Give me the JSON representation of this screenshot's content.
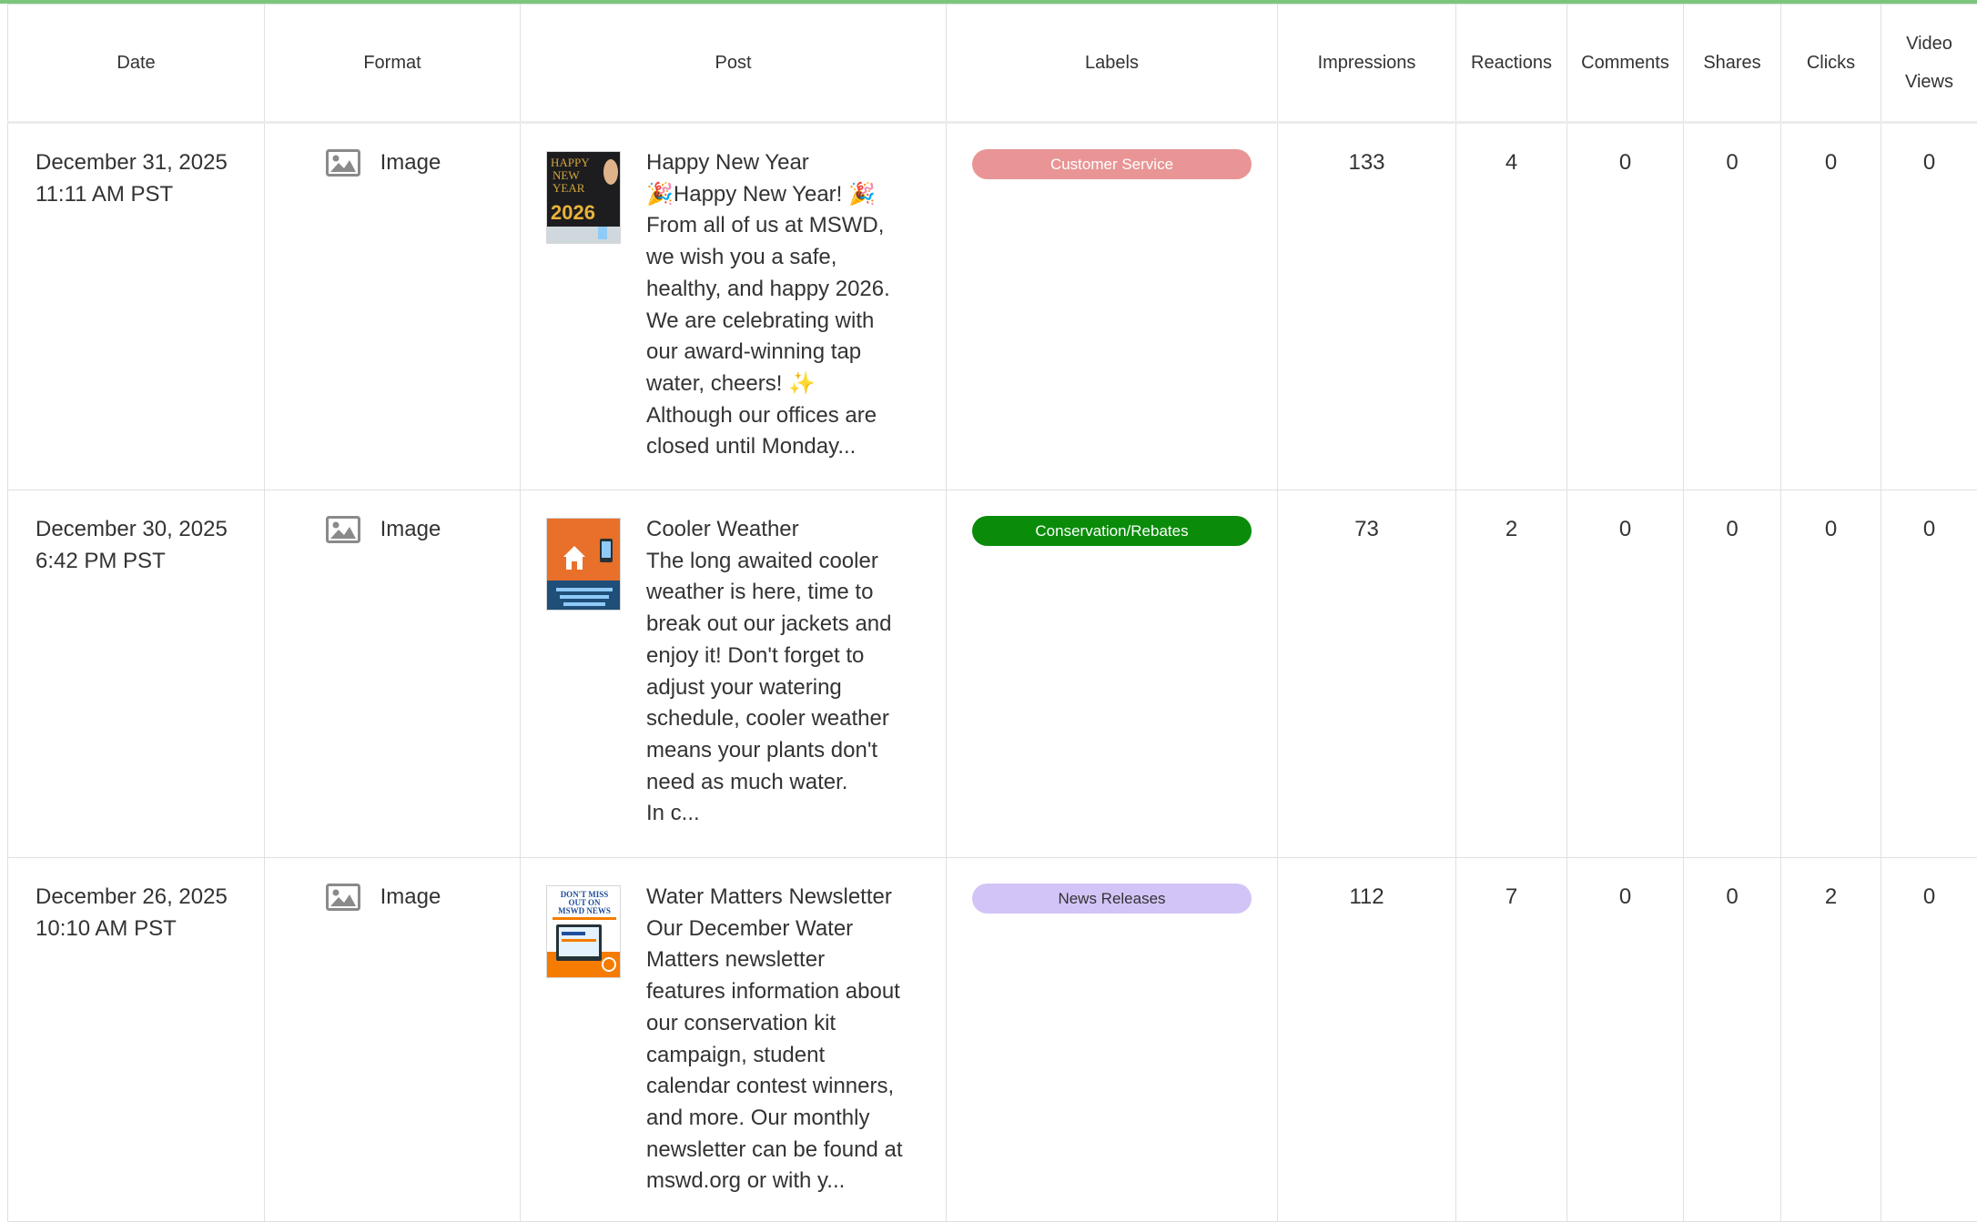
{
  "columns": {
    "date": "Date",
    "format": "Format",
    "post": "Post",
    "labels": "Labels",
    "impressions": "Impressions",
    "reactions": "Reactions",
    "comments": "Comments",
    "shares": "Shares",
    "clicks": "Clicks",
    "video_views_line1": "Video",
    "video_views_line2": "Views"
  },
  "rows": [
    {
      "date": "December 31, 2025",
      "time": "11:11 AM PST",
      "format": "Image",
      "format_icon": "image-icon",
      "post_lines": [
        "Happy New Year",
        "🎉Happy New Year! 🎉",
        "From all of us at MSWD,",
        "we wish you a safe,",
        "healthy, and happy 2026.",
        "We are celebrating with",
        "our award-winning tap",
        "water, cheers! ✨",
        "Although our offices are",
        "closed until Monday..."
      ],
      "thumbnail_text": [
        "HAPPY",
        "NEW",
        "YEAR",
        "2026"
      ],
      "label": "Customer Service",
      "label_color": "#e99595",
      "label_text_color": "#ffffff",
      "impressions": "133",
      "reactions": "4",
      "comments": "0",
      "shares": "0",
      "clicks": "0",
      "video_views": "0"
    },
    {
      "date": "December 30, 2025",
      "time": "6:42 PM PST",
      "format": "Image",
      "format_icon": "image-icon",
      "post_lines": [
        "Cooler Weather",
        "The long awaited cooler",
        "weather is here, time to",
        "break out our jackets and",
        "enjoy it! Don't forget to",
        "adjust your watering",
        "schedule, cooler weather",
        "means your plants don't",
        "need as much water.",
        "In c..."
      ],
      "thumbnail_text": [],
      "label": "Conservation/Rebates",
      "label_color": "#0a8c0a",
      "label_text_color": "#ffffff",
      "impressions": "73",
      "reactions": "2",
      "comments": "0",
      "shares": "0",
      "clicks": "0",
      "video_views": "0"
    },
    {
      "date": "December 26, 2025",
      "time": "10:10 AM PST",
      "format": "Image",
      "format_icon": "image-icon",
      "post_lines": [
        "Water Matters Newsletter",
        "Our December Water",
        "Matters newsletter",
        "features information about",
        "our conservation kit",
        "campaign, student",
        "calendar contest winners,",
        "and more. Our monthly",
        "newsletter can be found at",
        "mswd.org or with y..."
      ],
      "thumbnail_text": [
        "DON'T MISS",
        "OUT ON",
        "MSWD NEWS"
      ],
      "label": "News Releases",
      "label_color": "#d3c4f7",
      "label_text_color": "#333333",
      "impressions": "112",
      "reactions": "7",
      "comments": "0",
      "shares": "0",
      "clicks": "2",
      "video_views": "0"
    }
  ]
}
